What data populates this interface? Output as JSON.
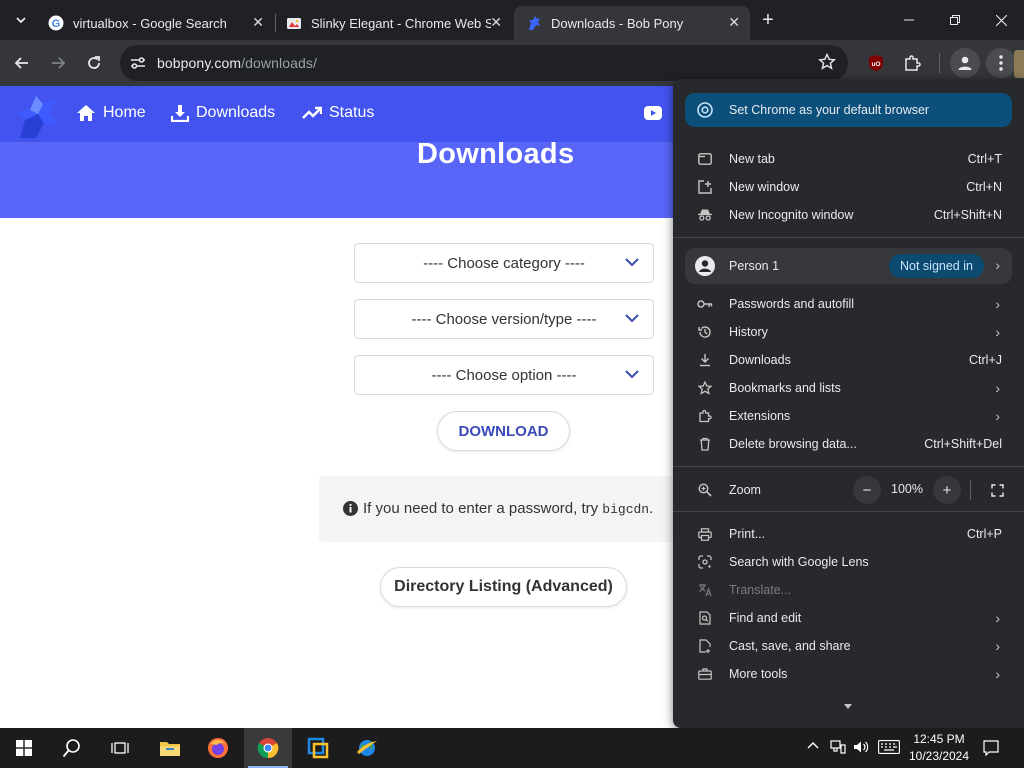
{
  "browser": {
    "tabs": [
      {
        "title": "virtualbox - Google Search",
        "favicon": "google-icon",
        "active": false
      },
      {
        "title": "Slinky Elegant - Chrome Web St",
        "favicon": "chrome-web-store-icon",
        "active": false
      },
      {
        "title": "Downloads - Bob Pony",
        "favicon": "bobpony-icon",
        "active": true
      }
    ],
    "url_domain": "bobpony.com",
    "url_path": "/downloads/"
  },
  "page": {
    "nav": {
      "home": "Home",
      "downloads": "Downloads",
      "status": "Status"
    },
    "title": "Downloads",
    "selects": {
      "category": "---- Choose category ----",
      "version": "---- Choose version/type ----",
      "option": "---- Choose option ----"
    },
    "download_button": "DOWNLOAD",
    "notice_text": "If you need to enter a password, try ",
    "notice_code": "bigcdn",
    "notice_end": ".",
    "directory_button": "Directory Listing (Advanced)"
  },
  "chrome_menu": {
    "default_browser": "Set Chrome as your default browser",
    "new_tab": {
      "label": "New tab",
      "shortcut": "Ctrl+T"
    },
    "new_window": {
      "label": "New window",
      "shortcut": "Ctrl+N"
    },
    "incognito": {
      "label": "New Incognito window",
      "shortcut": "Ctrl+Shift+N"
    },
    "person": {
      "label": "Person 1",
      "status": "Not signed in"
    },
    "passwords": {
      "label": "Passwords and autofill"
    },
    "history": {
      "label": "History"
    },
    "downloads": {
      "label": "Downloads",
      "shortcut": "Ctrl+J"
    },
    "bookmarks": {
      "label": "Bookmarks and lists"
    },
    "extensions": {
      "label": "Extensions"
    },
    "delete_data": {
      "label": "Delete browsing data...",
      "shortcut": "Ctrl+Shift+Del"
    },
    "zoom": {
      "label": "Zoom",
      "value": "100%",
      "minus": "−",
      "plus": "+"
    },
    "print": {
      "label": "Print...",
      "shortcut": "Ctrl+P"
    },
    "lens": {
      "label": "Search with Google Lens"
    },
    "translate": {
      "label": "Translate..."
    },
    "find": {
      "label": "Find and edit"
    },
    "cast": {
      "label": "Cast, save, and share"
    },
    "more_tools": {
      "label": "More tools"
    }
  },
  "taskbar": {
    "time": "12:45 PM",
    "date": "10/23/2024"
  },
  "colors": {
    "hero": "#5865f6",
    "navbar": "#4353ef",
    "menu_bg": "#28292c",
    "banner": "#0b4f7a",
    "link": "#3a4ab8"
  }
}
